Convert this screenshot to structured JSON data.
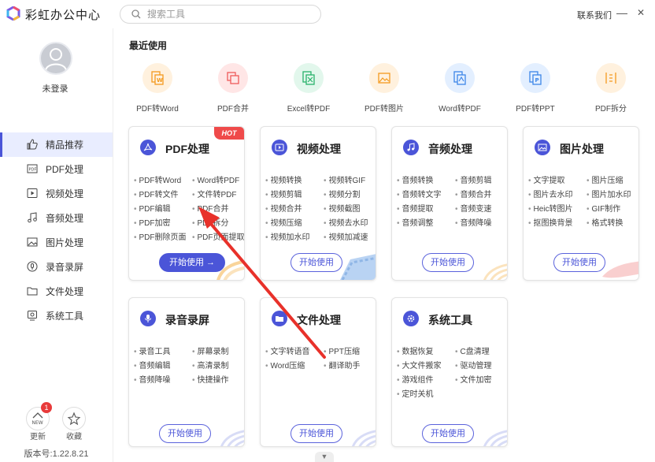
{
  "app": {
    "title": "彩虹办公中心"
  },
  "search": {
    "placeholder": "搜索工具"
  },
  "header": {
    "contact": "联系我们",
    "minimize": "—",
    "close": "✕"
  },
  "user": {
    "login_label": "未登录"
  },
  "sidebar": {
    "items": [
      {
        "label": "精品推荐",
        "icon": "thumbs-up-icon"
      },
      {
        "label": "PDF处理",
        "icon": "pdf-icon"
      },
      {
        "label": "视频处理",
        "icon": "video-icon"
      },
      {
        "label": "音频处理",
        "icon": "music-icon"
      },
      {
        "label": "图片处理",
        "icon": "image-icon"
      },
      {
        "label": "录音录屏",
        "icon": "record-icon"
      },
      {
        "label": "文件处理",
        "icon": "folder-icon"
      },
      {
        "label": "系统工具",
        "icon": "monitor-icon"
      }
    ],
    "update_label": "更新",
    "update_badge": "1",
    "new_tag": "NEW",
    "favorite_label": "收藏",
    "version": "版本号:1.22.8.21"
  },
  "recent": {
    "title": "最近使用",
    "items": [
      {
        "label": "PDF转Word",
        "bg": "#fff1de",
        "fg": "#f39a1e"
      },
      {
        "label": "PDF合并",
        "bg": "#ffe6e6",
        "fg": "#ef5a5a"
      },
      {
        "label": "Excel转PDF",
        "bg": "#e2f7ec",
        "fg": "#28b36b"
      },
      {
        "label": "PDF转图片",
        "bg": "#fff1de",
        "fg": "#f39a1e"
      },
      {
        "label": "Word转PDF",
        "bg": "#e3efff",
        "fg": "#3d86e8"
      },
      {
        "label": "PDF转PPT",
        "bg": "#e3efff",
        "fg": "#3d86e8"
      },
      {
        "label": "PDF拆分",
        "bg": "#fff1de",
        "fg": "#f39a1e"
      }
    ]
  },
  "cards": {
    "pdf": {
      "title": "PDF处理",
      "hot": "HOT",
      "button": "开始使用 →",
      "features": [
        "PDF转Word",
        "Word转PDF",
        "PDF转文件",
        "文件转PDF",
        "PDF编辑",
        "PDF合并",
        "PDF加密",
        "PDF拆分",
        "PDF删除页面",
        "PDF页面提取"
      ]
    },
    "video": {
      "title": "视频处理",
      "button": "开始使用",
      "features": [
        "视频转换",
        "视频转GIF",
        "视频剪辑",
        "视频分割",
        "视频合并",
        "视频截图",
        "视频压缩",
        "视频去水印",
        "视频加水印",
        "视频加减速"
      ]
    },
    "audio": {
      "title": "音频处理",
      "button": "开始使用",
      "features": [
        "音频转换",
        "音频剪辑",
        "音频转文字",
        "音频合并",
        "音频提取",
        "音频变速",
        "音频调整",
        "音频降噪"
      ]
    },
    "image": {
      "title": "图片处理",
      "button": "开始使用",
      "features": [
        "文字提取",
        "图片压缩",
        "图片去水印",
        "图片加水印",
        "Heic转图片",
        "GIF制作",
        "抠图换背景",
        "格式转换"
      ]
    },
    "record": {
      "title": "录音录屏",
      "button": "开始使用",
      "features": [
        "录音工具",
        "屏幕录制",
        "音频编辑",
        "高清录制",
        "音频降噪",
        "快捷操作"
      ]
    },
    "file": {
      "title": "文件处理",
      "button": "开始使用",
      "features": [
        "文字转语音",
        "PPT压缩",
        "Word压缩",
        "翻译助手"
      ]
    },
    "system": {
      "title": "系统工具",
      "button": "开始使用",
      "features": [
        "数据恢复",
        "C盘清理",
        "大文件搬家",
        "驱动管理",
        "游戏组件",
        "文件加密",
        "定时关机"
      ]
    }
  },
  "colors": {
    "accent": "#4b55d8",
    "hot": "#ef4a4a",
    "annotation_arrow": "#e8312a"
  }
}
